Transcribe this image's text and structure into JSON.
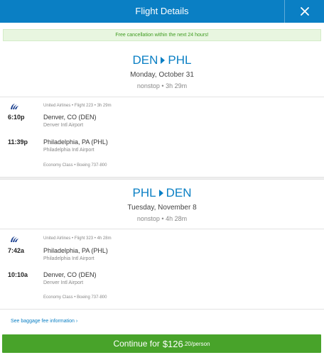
{
  "header": {
    "title": "Flight Details",
    "close_icon": "close-icon"
  },
  "banner": {
    "text": "Free cancellation within the next 24 hours!"
  },
  "colors": {
    "brand": "#0a7fc4",
    "cta": "#48a32a",
    "banner_text": "#3e9a1f"
  },
  "outbound": {
    "origin": "DEN",
    "destination": "PHL",
    "date": "Monday, October 31",
    "summary": "nonstop • 3h 29m",
    "flight_info": "United Airlines • Flight 223 • 3h 29m",
    "depart_time": "6:10p",
    "depart_city": "Denver, CO (DEN)",
    "depart_airport": "Denver Intl Airport",
    "arrive_time": "11:39p",
    "arrive_city": "Philadelphia, PA (PHL)",
    "arrive_airport": "Philadelphia Intl Airport",
    "cabin": "Economy Class • Boeing 737-800"
  },
  "return": {
    "origin": "PHL",
    "destination": "DEN",
    "date": "Tuesday, November 8",
    "summary": "nonstop • 4h 28m",
    "flight_info": "United Airlines • Flight 323 • 4h 28m",
    "depart_time": "7:42a",
    "depart_city": "Philadelphia, PA (PHL)",
    "depart_airport": "Philadelphia Intl Airport",
    "arrive_time": "10:10a",
    "arrive_city": "Denver, CO (DEN)",
    "arrive_airport": "Denver Intl Airport",
    "cabin": "Economy Class • Boeing 737-800"
  },
  "baggage_link": "See baggage fee information",
  "cta": {
    "label": "Continue for",
    "amount": "$126",
    "suffix": ".20/person"
  }
}
